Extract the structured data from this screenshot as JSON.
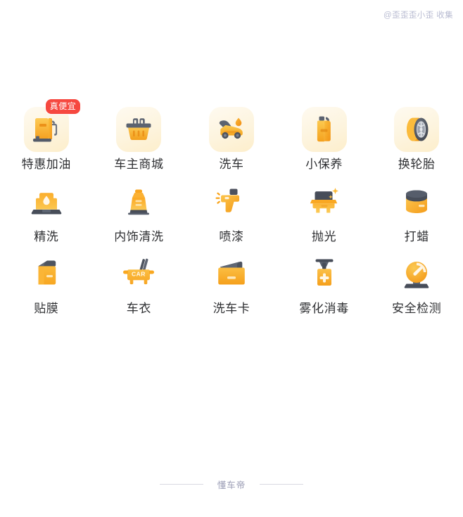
{
  "watermark": "@歪歪歪小歪 收集",
  "theme": {
    "accent_orange": "#F8A81B",
    "accent_orange_light": "#FBC34A",
    "badge_red": "#F6483F",
    "tile_bg": "#FDF4DE",
    "label_color": "#2F3033",
    "footer_color": "#9A9CB4",
    "dark_slate": "#4A4F5C"
  },
  "grid": {
    "columns": 5,
    "rows": [
      {
        "has_tile": true,
        "items": [
          {
            "label": "特惠加油",
            "icon": "gas-pump-icon",
            "badge": "真便宜"
          },
          {
            "label": "车主商城",
            "icon": "shopping-basket-icon",
            "badge": null
          },
          {
            "label": "洗车",
            "icon": "car-wash-icon",
            "badge": null
          },
          {
            "label": "小保养",
            "icon": "oil-canister-icon",
            "badge": null
          },
          {
            "label": "换轮胎",
            "icon": "tire-icon",
            "badge": null
          }
        ]
      },
      {
        "has_tile": false,
        "items": [
          {
            "label": "精洗",
            "icon": "deep-clean-icon",
            "badge": null
          },
          {
            "label": "内饰清洗",
            "icon": "interior-clean-icon",
            "badge": null
          },
          {
            "label": "喷漆",
            "icon": "spray-gun-icon",
            "badge": null
          },
          {
            "label": "抛光",
            "icon": "polish-car-icon",
            "badge": null
          },
          {
            "label": "打蜡",
            "icon": "wax-jar-icon",
            "badge": null
          }
        ]
      },
      {
        "has_tile": false,
        "items": [
          {
            "label": "贴膜",
            "icon": "film-roll-icon",
            "badge": null
          },
          {
            "label": "车衣",
            "icon": "car-cover-icon",
            "badge": null
          },
          {
            "label": "洗车卡",
            "icon": "wash-card-icon",
            "badge": null
          },
          {
            "label": "雾化消毒",
            "icon": "sprayer-bottle-icon",
            "badge": null
          },
          {
            "label": "安全检测",
            "icon": "gauge-icon",
            "badge": null
          }
        ]
      }
    ]
  },
  "footer": {
    "text": "懂车帝"
  }
}
